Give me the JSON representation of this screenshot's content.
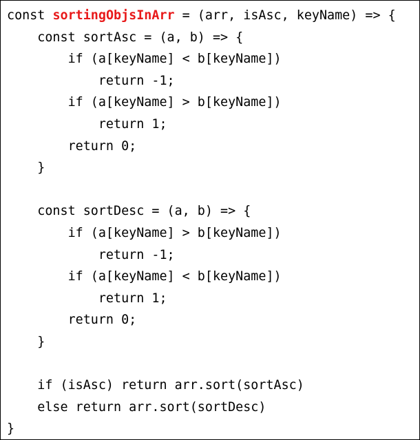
{
  "code": {
    "highlight_color": "#e8191a",
    "line_0": {
      "prefix": "const ",
      "function_name": "sortingObjsInArr",
      "suffix": " = (arr, isAsc, keyName) => {"
    },
    "line_1": "    const sortAsc = (a, b) => {",
    "line_2": "        if (a[keyName] < b[keyName])",
    "line_3": "            return -1;",
    "line_4": "        if (a[keyName] > b[keyName])",
    "line_5": "            return 1;",
    "line_6": "        return 0;",
    "line_7": "    }",
    "line_8": "",
    "line_9": "    const sortDesc = (a, b) => {",
    "line_10": "        if (a[keyName] > b[keyName])",
    "line_11": "            return -1;",
    "line_12": "        if (a[keyName] < b[keyName])",
    "line_13": "            return 1;",
    "line_14": "        return 0;",
    "line_15": "    }",
    "line_16": "",
    "line_17": "    if (isAsc) return arr.sort(sortAsc)",
    "line_18": "    else return arr.sort(sortDesc)",
    "line_19": "}"
  }
}
